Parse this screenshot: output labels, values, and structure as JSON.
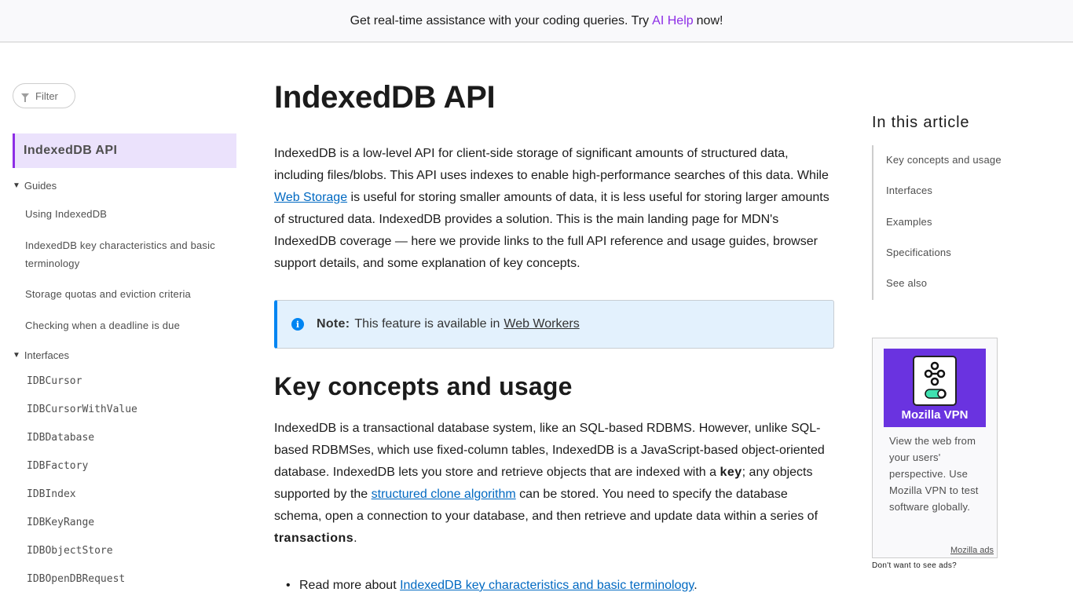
{
  "banner": {
    "text_before": "Get real-time assistance with your coding queries. Try",
    "link": "AI Help",
    "text_after": "now!",
    "link_color": "#8d2ee6"
  },
  "sidebar": {
    "filter_placeholder": "Filter",
    "filter_icon": "funnel-icon",
    "current": "IndexedDB API",
    "groups": [
      {
        "label": "Guides",
        "items": [
          "Using IndexedDB",
          "IndexedDB key characteristics and basic terminology",
          "Storage quotas and eviction criteria",
          "Checking when a deadline is due"
        ]
      },
      {
        "label": "Interfaces",
        "items": [
          "IDBCursor",
          "IDBCursorWithValue",
          "IDBDatabase",
          "IDBFactory",
          "IDBIndex",
          "IDBKeyRange",
          "IDBObjectStore",
          "IDBOpenDBRequest"
        ]
      }
    ]
  },
  "main": {
    "title": "IndexedDB API",
    "intro": {
      "t1": "IndexedDB is a low-level API for client-side storage of significant amounts of structured data, including files/blobs. This API uses indexes to enable high-performance searches of this data. While ",
      "link": "Web Storage",
      "t2": " is useful for storing smaller amounts of data, it is less useful for storing larger amounts of structured data. IndexedDB provides a solution. This is the main landing page for MDN's IndexedDB coverage — here we provide links to the full API reference and usage guides, browser support details, and some explanation of key concepts."
    },
    "note": {
      "icon": "info-icon",
      "label": "Note:",
      "text": "This feature is available in",
      "link": "Web Workers"
    },
    "section_title": "Key concepts and usage",
    "concepts": {
      "t1": "IndexedDB is a transactional database system, like an SQL-based RDBMS. However, unlike SQL-based RDBMSes, which use fixed-column tables, IndexedDB is a JavaScript-based object-oriented database. IndexedDB lets you store and retrieve objects that are indexed with a ",
      "b1": "key",
      "t2": "; any objects supported by the ",
      "link": "structured clone algorithm",
      "t3": " can be stored. You need to specify the database schema, open a connection to your database, and then retrieve and update data within a series of ",
      "b2": "transactions",
      "t4": "."
    },
    "bullet": {
      "text": "Read more about ",
      "link": "IndexedDB key characteristics and basic terminology",
      "end": "."
    }
  },
  "toc": {
    "title": "In this article",
    "items": [
      "Key concepts and usage",
      "Interfaces",
      "Examples",
      "Specifications",
      "See also"
    ]
  },
  "ad": {
    "brand": "Mozilla VPN",
    "text": "View the web from your users' perspective. Use Mozilla VPN to test software globally.",
    "link": "Mozilla ads",
    "optout": "Don't want to see ads?",
    "banner_color": "#6a33e0"
  }
}
